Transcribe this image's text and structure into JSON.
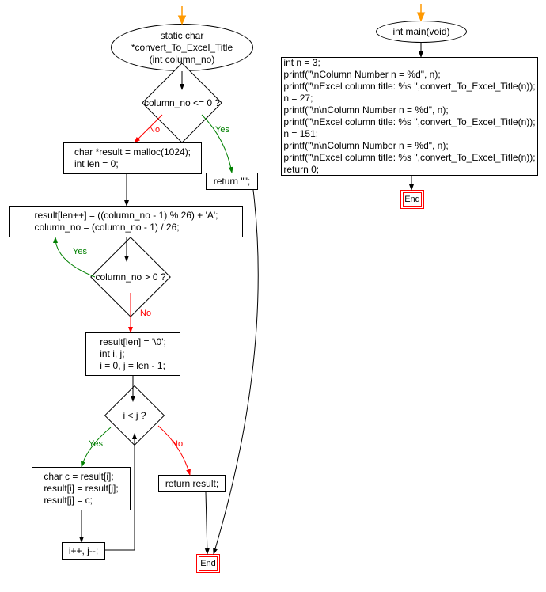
{
  "yesLabel": "Yes",
  "noLabel": "No",
  "endLabel": "End",
  "func1": {
    "signature": "static char\n*convert_To_Excel_Title\n(int column_no)",
    "decision1": "column_no <= 0 ?",
    "alloc": "char *result = malloc(1024);\nint len = 0;",
    "returnEmpty": "return \"\";",
    "loopBody": "result[len++] = ((column_no - 1) % 26) + 'A';\ncolumn_no = (column_no - 1) / 26;",
    "decision2": "column_no > 0 ?",
    "postLoop": "result[len] = '\\0';\nint i, j;\ni = 0, j = len - 1;",
    "decision3": "i < j ?",
    "swap": "char c = result[i];\nresult[i] = result[j];\nresult[j] = c;",
    "incr": "i++, j--;",
    "returnResult": "return result;"
  },
  "func2": {
    "signature": "int main(void)",
    "body": "int n = 3;\nprintf(\"\\nColumn Number n = %d\", n);\nprintf(\"\\nExcel column title: %s \",convert_To_Excel_Title(n));\nn = 27;\nprintf(\"\\n\\nColumn Number n = %d\", n);\nprintf(\"\\nExcel column title: %s \",convert_To_Excel_Title(n));\nn = 151;\nprintf(\"\\n\\nColumn Number n = %d\", n);\nprintf(\"\\nExcel column title: %s \",convert_To_Excel_Title(n));\nreturn 0;"
  }
}
